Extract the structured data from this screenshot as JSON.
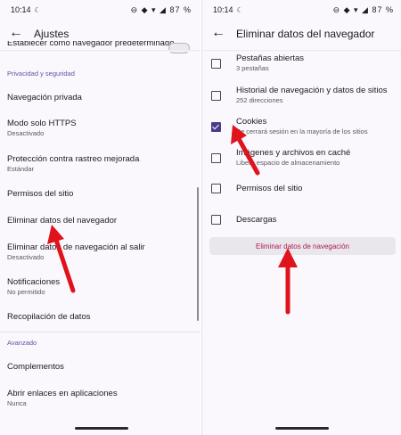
{
  "left": {
    "status": {
      "time": "10:14",
      "icons": "⊖ ◆ ▾ ◢ 87 %"
    },
    "title": "Ajustes",
    "top_setting": "Establecer como navegador predeterminado",
    "section_privacy": "Privacidad y seguridad",
    "items": [
      {
        "title": "Navegación privada",
        "subtitle": ""
      },
      {
        "title": "Modo solo HTTPS",
        "subtitle": "Desactivado"
      },
      {
        "title": "Protección contra rastreo mejorada",
        "subtitle": "Estándar"
      },
      {
        "title": "Permisos del sitio",
        "subtitle": ""
      },
      {
        "title": "Eliminar datos del navegador",
        "subtitle": ""
      },
      {
        "title": "Eliminar datos de navegación al salir",
        "subtitle": "Desactivado"
      },
      {
        "title": "Notificaciones",
        "subtitle": "No permitido"
      },
      {
        "title": "Recopilación de datos",
        "subtitle": ""
      }
    ],
    "section_advanced": "Avanzado",
    "advanced_items": [
      {
        "title": "Complementos",
        "subtitle": ""
      },
      {
        "title": "Abrir enlaces en aplicaciones",
        "subtitle": "Nunca"
      }
    ]
  },
  "right": {
    "status": {
      "time": "10:14",
      "icons": "⊖ ◆ ▾ ◢ 87 %"
    },
    "title": "Eliminar datos del navegador",
    "options": [
      {
        "title": "Pestañas abiertas",
        "subtitle": "3 pestañas",
        "checked": false
      },
      {
        "title": "Historial de navegación y datos de sitios",
        "subtitle": "252 direcciones",
        "checked": false
      },
      {
        "title": "Cookies",
        "subtitle": "Se cerrará sesión en la mayoría de los sitios",
        "checked": true
      },
      {
        "title": "Imágenes y archivos en caché",
        "subtitle": "Libera espacio de almacenamiento",
        "checked": false
      },
      {
        "title": "Permisos del sitio",
        "subtitle": "",
        "checked": false
      },
      {
        "title": "Descargas",
        "subtitle": "",
        "checked": false
      }
    ],
    "button_label": "Eliminar datos de navegación"
  },
  "colors": {
    "accent": "#6750a4",
    "checkbox": "#4a3c8c",
    "button_text": "#b0195a",
    "arrow": "#e0121b"
  }
}
